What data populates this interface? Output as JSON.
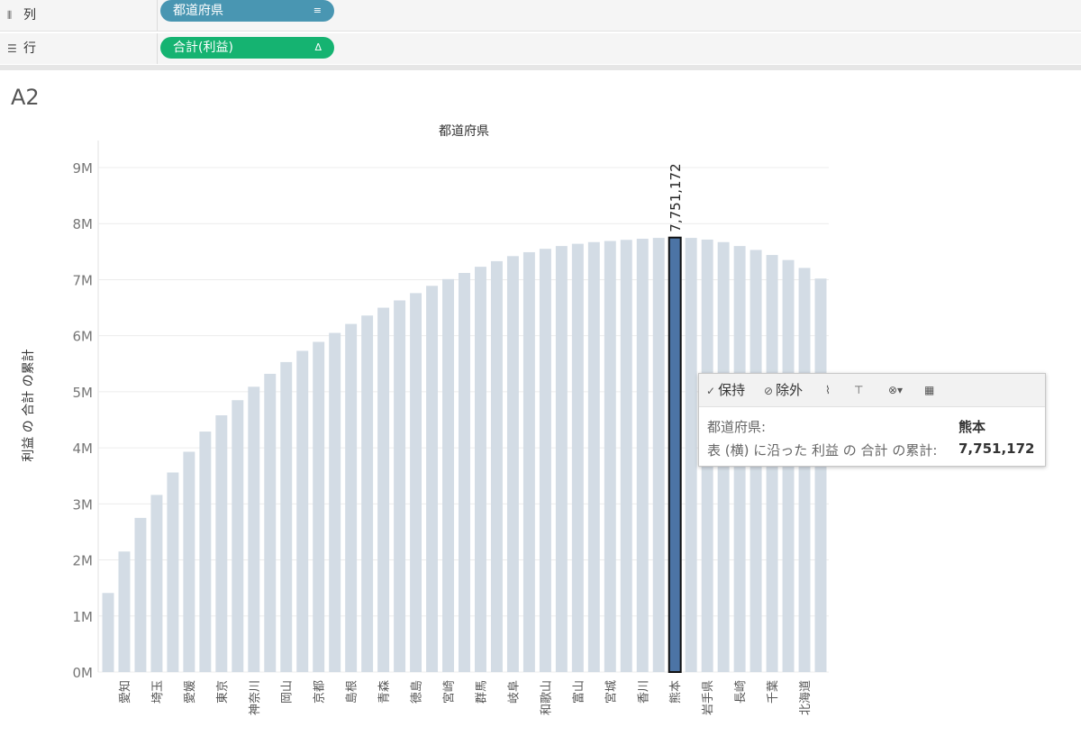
{
  "shelves": {
    "columns": {
      "label": "列",
      "pill": "都道府県"
    },
    "rows": {
      "label": "行",
      "pill": "合計(利益)"
    }
  },
  "sheet_title": "A2",
  "tooltip": {
    "keep_label": "保持",
    "exclude_label": "除外",
    "field_label": "都道府県:",
    "field_value": "熊本",
    "measure_label": "表 (横) に沿った 利益 の 合計 の累計:",
    "measure_value": "7,751,172"
  },
  "chart_data": {
    "type": "bar",
    "title": "都道府県",
    "ylabel": "利益 の 合計 の累計",
    "xlabel": "",
    "ylim": [
      0,
      9000000
    ],
    "y_ticks": [
      "0M",
      "1M",
      "2M",
      "3M",
      "4M",
      "5M",
      "6M",
      "7M",
      "8M",
      "9M"
    ],
    "grid": true,
    "categories": [
      "",
      "愛知",
      "",
      "埼玉",
      "",
      "愛媛",
      "",
      "東京",
      "",
      "神奈川",
      "",
      "岡山",
      "",
      "京都",
      "",
      "島根",
      "",
      "青森",
      "",
      "徳島",
      "",
      "宮崎",
      "",
      "群馬",
      "",
      "岐阜",
      "",
      "和歌山",
      "",
      "富山",
      "",
      "宮城",
      "",
      "香川",
      "",
      "熊本",
      "",
      "岩手県",
      "",
      "長崎",
      "",
      "千葉",
      "",
      "北海道",
      ""
    ],
    "values": [
      1410000,
      2150000,
      2750000,
      3160000,
      3560000,
      3930000,
      4290000,
      4580000,
      4850000,
      5090000,
      5320000,
      5530000,
      5730000,
      5890000,
      6050000,
      6210000,
      6360000,
      6500000,
      6630000,
      6760000,
      6890000,
      7010000,
      7120000,
      7230000,
      7330000,
      7420000,
      7490000,
      7550000,
      7600000,
      7640000,
      7670000,
      7690000,
      7710000,
      7730000,
      7745000,
      7751172,
      7745000,
      7715000,
      7670000,
      7600000,
      7530000,
      7440000,
      7350000,
      7210000,
      7020000
    ],
    "highlight_index": 35,
    "highlight_label": "7,751,172",
    "colors": {
      "bar": "#d3dce5",
      "highlight": "#4c74a5",
      "grid": "#ececec"
    }
  }
}
